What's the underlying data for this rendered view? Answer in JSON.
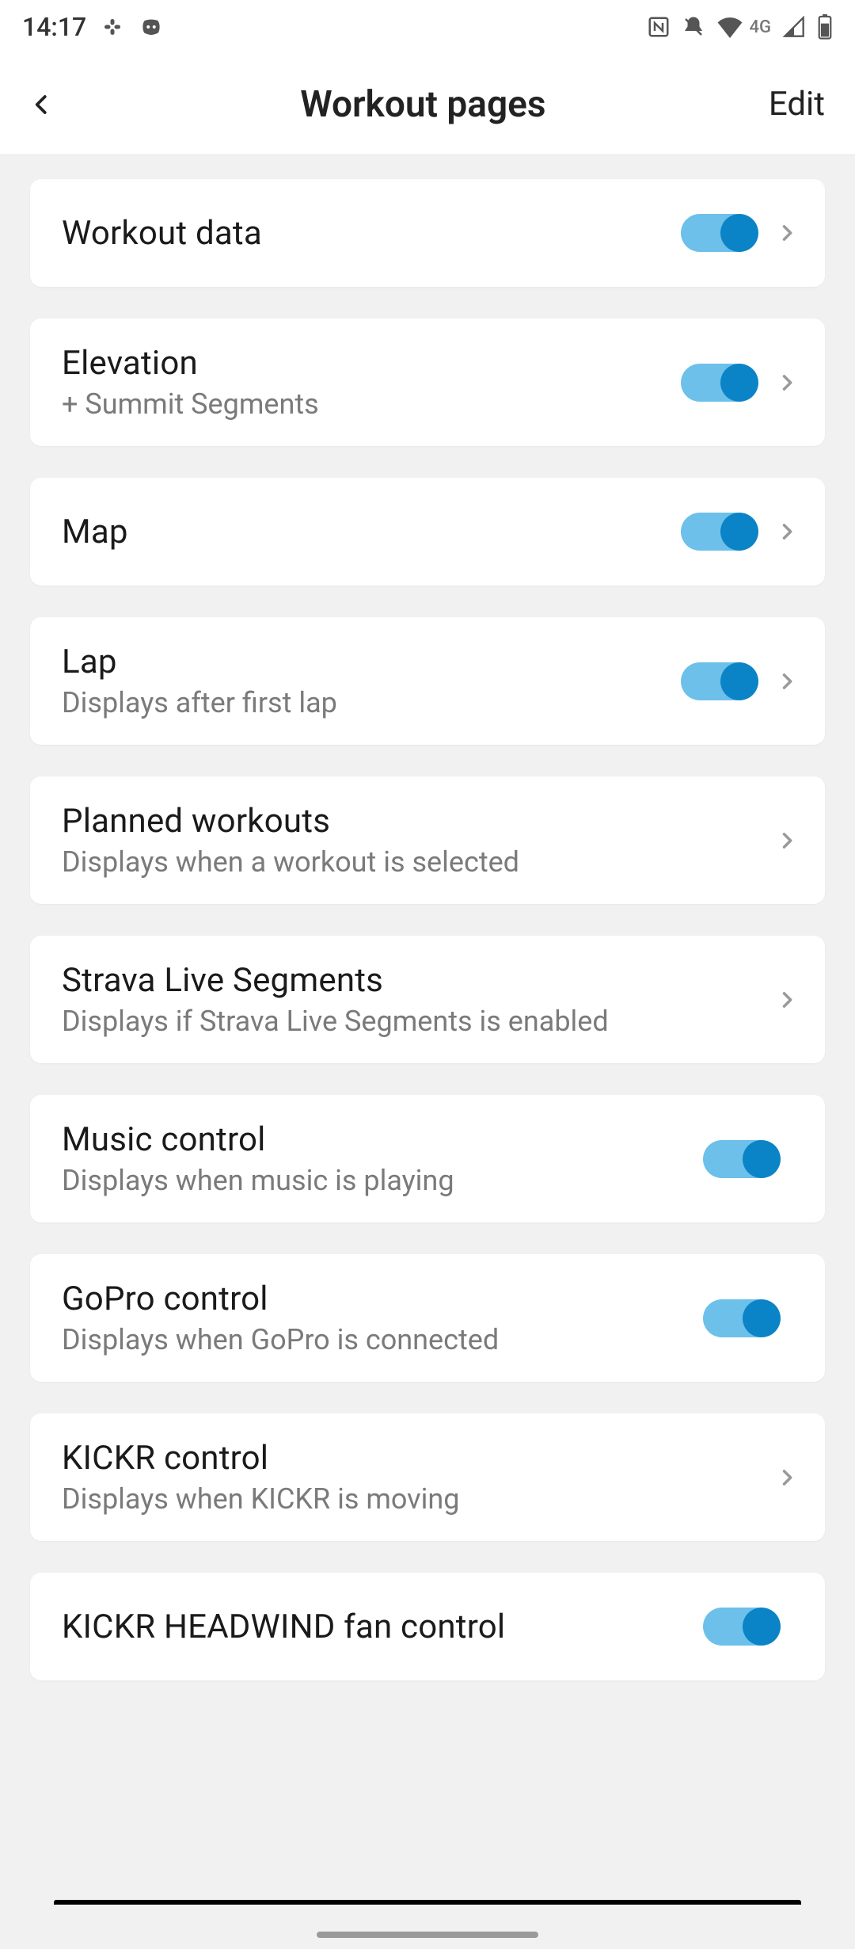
{
  "status": {
    "time": "14:17",
    "network_label": "4G"
  },
  "header": {
    "title": "Workout pages",
    "edit": "Edit"
  },
  "items": [
    {
      "title": "Workout data",
      "subtitle": "",
      "toggle": true,
      "chevron": true
    },
    {
      "title": "Elevation",
      "subtitle": "+ Summit Segments",
      "toggle": true,
      "chevron": true
    },
    {
      "title": "Map",
      "subtitle": "",
      "toggle": true,
      "chevron": true
    },
    {
      "title": "Lap",
      "subtitle": "Displays after first lap",
      "toggle": true,
      "chevron": true
    },
    {
      "title": "Planned workouts",
      "subtitle": "Displays when a workout is selected",
      "toggle": false,
      "chevron": true
    },
    {
      "title": "Strava Live Segments",
      "subtitle": "Displays if Strava Live Segments is enabled",
      "toggle": false,
      "chevron": true
    },
    {
      "title": "Music control",
      "subtitle": "Displays when music is playing",
      "toggle": true,
      "chevron": false
    },
    {
      "title": "GoPro control",
      "subtitle": "Displays when GoPro is connected",
      "toggle": true,
      "chevron": false
    },
    {
      "title": "KICKR control",
      "subtitle": "Displays when KICKR is moving",
      "toggle": false,
      "chevron": true
    },
    {
      "title": "KICKR HEADWIND fan control",
      "subtitle": "",
      "toggle": true,
      "chevron": false
    }
  ]
}
